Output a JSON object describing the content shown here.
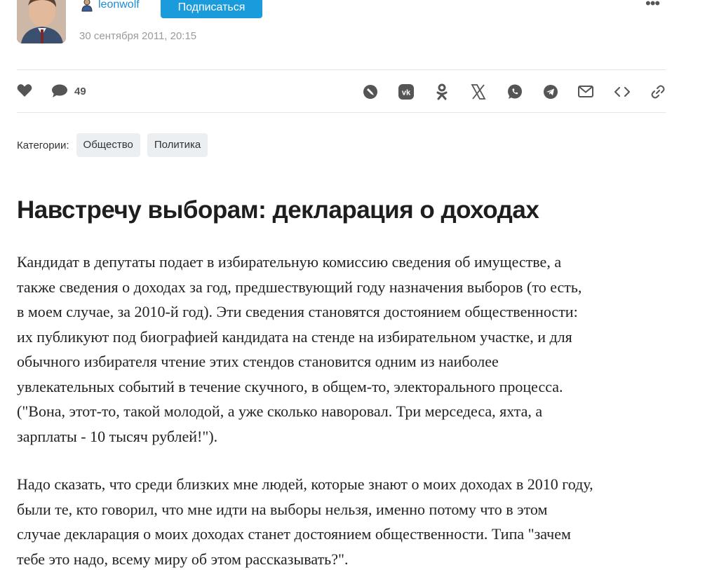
{
  "author": {
    "username": "leonwolf",
    "subscribe_label": "Подписаться",
    "date": "30 сентября 2011, 20:15",
    "more_label": "•••"
  },
  "actions": {
    "comment_count": "49",
    "share_icons": [
      "livejournal-icon",
      "vk-icon",
      "odnoklassniki-icon",
      "x-icon",
      "whatsapp-icon",
      "telegram-icon",
      "email-icon",
      "embed-icon",
      "link-icon"
    ]
  },
  "categories": {
    "label": "Категории:",
    "tags": [
      "Общество",
      "Политика"
    ]
  },
  "post": {
    "title": "Навстречу выборам: декларация о доходах",
    "paragraph1": [
      "Кандидат в депутаты подает в избирательную комиссию сведения об имуществе, а",
      "также сведения о доходах за год, предшествующий году назначения выборов (то есть,",
      "в моем случае, за 2010-й год). Эти сведения становятся достоянием общественности:",
      "их публикуют под биографией кандидата на стенде на избирательном участке, и для",
      "обычного избирателя чтение этих стендов становится одним из наиболее",
      "увлекательных событий в течение скучного, в общем-то, электорального процесса.",
      "(\"Вона, этот-то, такой молодой, а уже сколько наворовал. Три мерседеса, яхта, а",
      "зарплаты - 10 тысяч рублей!\")."
    ],
    "paragraph2": [
      "Надо сказать, что среди близких мне людей, которые знают о моих доходах в 2010 году,",
      "были те, кто говорил, что мне идти на выборы нельзя, именно потому что в этом",
      "случае декларация о моих доходах станет достоянием общественности. Типа \"зачем",
      "тебе это надо, всему миру об этом рассказывать?\"."
    ]
  },
  "colors": {
    "accent": "#1a9bdb",
    "link": "#1c8bd6",
    "icon": "#555555"
  }
}
